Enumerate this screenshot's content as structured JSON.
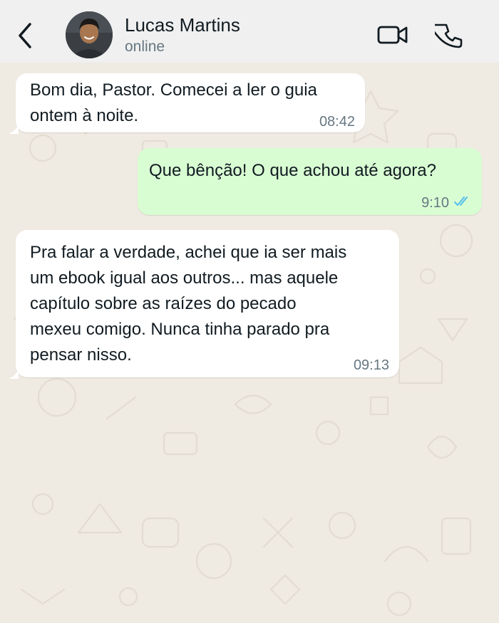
{
  "header": {
    "contact_name": "Lucas Martins",
    "status": "online",
    "icons": {
      "back": "chevron-left-icon",
      "video": "video-camera-icon",
      "call": "phone-icon"
    }
  },
  "messages": [
    {
      "direction": "incoming",
      "text": "Bom dia, Pastor. Comecei a ler o guia\nontem à noite.",
      "time": "08:42"
    },
    {
      "direction": "outgoing",
      "text": "Que bênção! O que achou até agora?",
      "time": "9:10",
      "status": "read"
    },
    {
      "direction": "incoming",
      "text": "Pra falar a verdade, achei que ia ser mais\num ebook igual aos outros... mas aquele\ncapítulo sobre as raízes do pecado\nmexeu comigo. Nunca tinha parado pra\npensar nisso.",
      "time": "09:13"
    }
  ],
  "colors": {
    "wallpaper": "#efeae2",
    "header_bg": "#f0f0f0",
    "incoming_bubble": "#ffffff",
    "outgoing_bubble": "#d9fdd3",
    "read_ticks": "#53bdeb"
  }
}
